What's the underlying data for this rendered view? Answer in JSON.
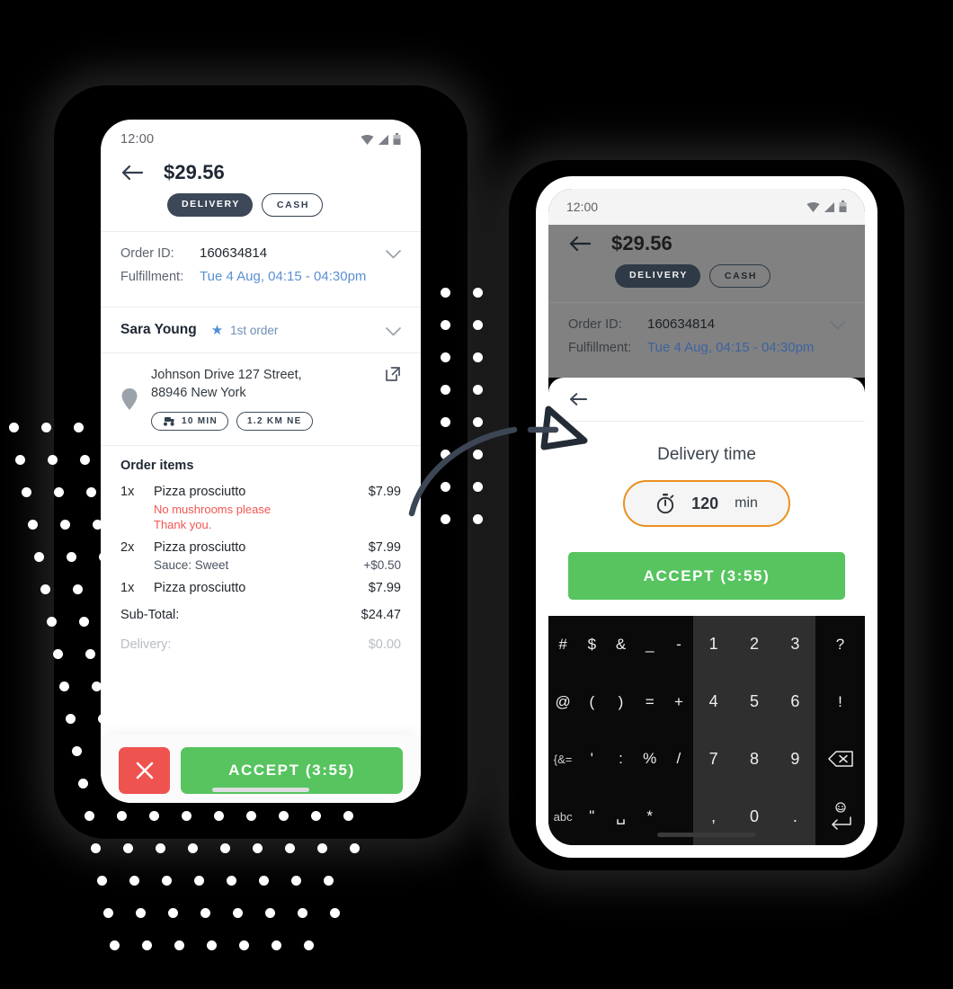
{
  "left_phone": {
    "status_bar": {
      "clock": "12:00",
      "icons": [
        "wifi-icon",
        "signal-icon",
        "battery-icon"
      ]
    },
    "header": {
      "back_icon": "back-arrow-icon",
      "amount": "$29.56",
      "chips": [
        {
          "label": "DELIVERY",
          "style": "filled"
        },
        {
          "label": "CASH",
          "style": "outline"
        }
      ]
    },
    "details": {
      "order_id_label": "Order ID:",
      "order_id_value": "160634814",
      "fulfillment_label": "Fulfillment:",
      "fulfillment_value": "Tue 4 Aug, 04:15 - 04:30pm",
      "expand_icon": "chevron-down-icon"
    },
    "customer": {
      "name": "Sara Young",
      "star_icon": "star-icon",
      "badge": "1st order",
      "expand_icon": "chevron-down-icon"
    },
    "address": {
      "pin_icon": "map-pin-icon",
      "line1": "Johnson Drive 127 Street,",
      "line2": "88946 New York",
      "external_icon": "external-link-icon",
      "pills": [
        {
          "icon": "scooter-icon",
          "label": "10 MIN"
        },
        {
          "icon": "",
          "label": "1.2 KM NE"
        }
      ]
    },
    "order_items": {
      "title": "Order items",
      "rows": [
        {
          "qty": "1x",
          "name": "Pizza prosciutto",
          "price": "$7.99",
          "note": "No mushrooms please\nThank you."
        },
        {
          "qty": "2x",
          "name": "Pizza prosciutto",
          "price": "$7.99",
          "option_name": "Sauce: Sweet",
          "option_price": "+$0.50"
        },
        {
          "qty": "1x",
          "name": "Pizza prosciutto",
          "price": "$7.99"
        }
      ]
    },
    "totals": [
      {
        "key": "Sub-Total:",
        "value": "$24.47",
        "dim": false
      },
      {
        "key": "Delivery:",
        "value": "$0.00",
        "dim": true
      }
    ],
    "actions": {
      "cancel_icon": "close-icon",
      "accept_label": "ACCEPT (3:55)"
    }
  },
  "right_phone": {
    "status_bar": {
      "clock": "12:00",
      "icons": [
        "wifi-icon",
        "signal-icon",
        "battery-icon"
      ]
    },
    "header": {
      "back_icon": "back-arrow-icon",
      "amount": "$29.56",
      "chips": [
        {
          "label": "DELIVERY",
          "style": "filled"
        },
        {
          "label": "CASH",
          "style": "outline"
        }
      ]
    },
    "details": {
      "order_id_label": "Order ID:",
      "order_id_value": "160634814",
      "fulfillment_label": "Fulfillment:",
      "fulfillment_value": "Tue 4 Aug, 04:15 - 04:30pm",
      "expand_icon": "chevron-down-icon"
    },
    "sheet": {
      "back_icon": "back-arrow-icon",
      "title": "Delivery time",
      "timer_icon": "stopwatch-icon",
      "time_value": "120",
      "time_unit": "min",
      "accept_label": "ACCEPT (3:55)"
    },
    "keyboard": {
      "symbol_rows": [
        [
          "#",
          "$",
          "&",
          "_",
          "-"
        ],
        [
          "@",
          "(",
          ")",
          "=",
          "+"
        ],
        [
          "{&=",
          "'",
          ":",
          "%",
          "/"
        ],
        [
          "abc",
          "\"",
          "␣",
          "*"
        ]
      ],
      "numeric_rows": [
        [
          "1",
          "2",
          "3"
        ],
        [
          "4",
          "5",
          "6"
        ],
        [
          "7",
          "8",
          "9"
        ],
        [
          ",",
          "0",
          "."
        ]
      ],
      "right_column": [
        "?",
        "!",
        "backspace-icon",
        "enter-icon"
      ]
    }
  },
  "annotation": {
    "arrow": "curved-arrow-pointing-right"
  },
  "colors": {
    "accent_green": "#57c45f",
    "accent_red": "#ef5350",
    "accent_orange": "#eb9020",
    "link_blue": "#5b8fd4",
    "note_red": "#f1564f",
    "chip_dark": "#3c4858",
    "background": "#000000"
  }
}
